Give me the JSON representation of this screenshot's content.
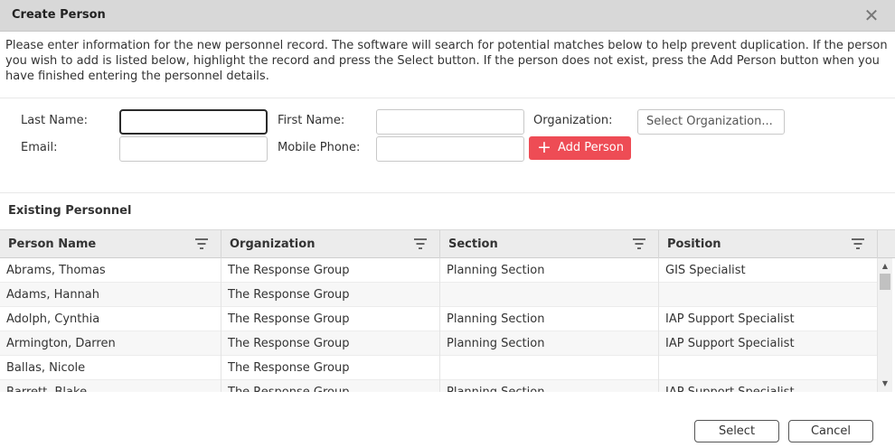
{
  "dialog": {
    "title": "Create Person",
    "intro": "Please enter information for the new personnel record. The software will search for potential matches below to help prevent duplication. If the person you wish to add is listed below, highlight the record and press the Select button. If the person does not exist, press the Add Person button when you have finished entering the personnel details."
  },
  "form": {
    "last_name_label": "Last Name:",
    "last_name_value": "",
    "first_name_label": "First Name:",
    "first_name_value": "",
    "organization_label": "Organization:",
    "organization_button": "Select Organization...",
    "email_label": "Email:",
    "email_value": "",
    "mobile_phone_label": "Mobile Phone:",
    "mobile_phone_value": "",
    "add_person_label": "Add Person"
  },
  "grid": {
    "title": "Existing Personnel",
    "columns": [
      "Person Name",
      "Organization",
      "Section",
      "Position"
    ],
    "rows": [
      [
        "Abrams, Thomas",
        "The Response Group",
        "Planning Section",
        "GIS Specialist"
      ],
      [
        "Adams, Hannah",
        "The Response Group",
        "",
        ""
      ],
      [
        "Adolph, Cynthia",
        "The Response Group",
        "Planning Section",
        "IAP Support Specialist"
      ],
      [
        "Armington, Darren",
        "The Response Group",
        "Planning Section",
        "IAP Support Specialist"
      ],
      [
        "Ballas, Nicole",
        "The Response Group",
        "",
        ""
      ],
      [
        "Barrett, Blake",
        "The Response Group",
        "Planning Section",
        "IAP Support Specialist"
      ]
    ]
  },
  "footer": {
    "select_label": "Select",
    "cancel_label": "Cancel"
  },
  "icons": {
    "close": "close-icon",
    "plus": "plus-icon",
    "filter": "filter-icon"
  },
  "colors": {
    "accent": "#ee4c55",
    "titlebar": "#d8d8d8"
  }
}
